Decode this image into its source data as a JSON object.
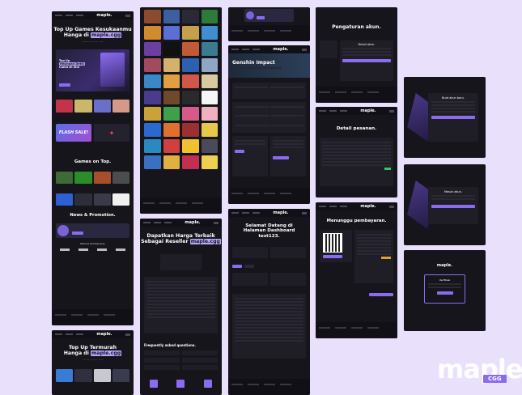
{
  "brand": {
    "logo": "maple.",
    "tag": "CGG",
    "small_logo": "maple."
  },
  "home": {
    "title_line1": "Top Up Games Kesukaanmu",
    "title_line2_prefix": "Hanga di ",
    "title_highlight": "maple.cgg",
    "banner_line1": "Top Up",
    "banner_line2": "Hitungan Detik",
    "banner_line3": "Cuma Di Sini",
    "promo_label": "FLASH SALE!",
    "section_games": "Games on Top.",
    "section_news": "News & Promotion.",
    "payment_title": "Metode Pembayaran"
  },
  "home2": {
    "title_line1": "Top Up Termurah",
    "title_line2_prefix": "Hanga di ",
    "title_highlight": "maple.cgg"
  },
  "reseller": {
    "title_line1": "Dapatkan Harga Terbaik",
    "title_line2_prefix": "Sebagai Reseller ",
    "title_highlight": "maple.cgg",
    "faq_title": "Frequently asked questions."
  },
  "genshin": {
    "title": "Genshin Impact"
  },
  "dashboard": {
    "title_line1": "Selamat Datang di",
    "title_line2": "Halaman Dashboard",
    "title_line3": "test123."
  },
  "settings": {
    "title": "Pengaturan akun.",
    "subtitle": "Detail akun."
  },
  "order": {
    "title": "Detail pesanan."
  },
  "payment": {
    "title": "Menunggu pembayaran."
  },
  "auth": {
    "login_title": "Masuk akun.",
    "register_title": "Buat akun baru.",
    "verify_title": "Verifikasi"
  },
  "colors": {
    "bg": "#e9e1fb",
    "panel": "#16151c",
    "accent": "#8b6cf0",
    "highlight": "#b7a6f5"
  }
}
